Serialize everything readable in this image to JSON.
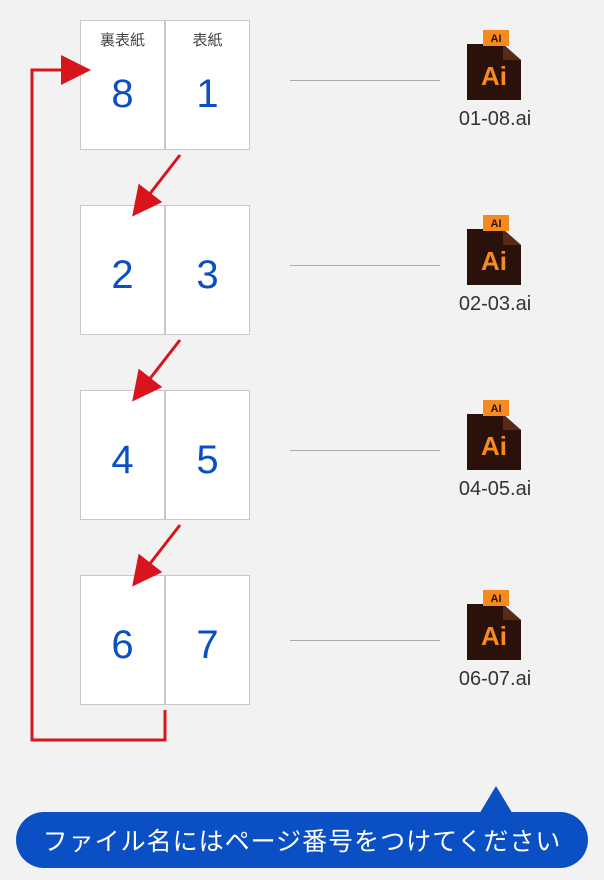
{
  "spreads": [
    {
      "left_label": "裏表紙",
      "left_num": "8",
      "right_label": "表紙",
      "right_num": "1"
    },
    {
      "left_label": "",
      "left_num": "2",
      "right_label": "",
      "right_num": "3"
    },
    {
      "left_label": "",
      "left_num": "4",
      "right_label": "",
      "right_num": "5"
    },
    {
      "left_label": "",
      "left_num": "6",
      "right_label": "",
      "right_num": "7"
    }
  ],
  "files": [
    {
      "name": "01-08.ai"
    },
    {
      "name": "02-03.ai"
    },
    {
      "name": "04-05.ai"
    },
    {
      "name": "06-07.ai"
    }
  ],
  "icon_text": {
    "tag": "AI",
    "letters": "Ai"
  },
  "banner_text": "ファイル名にはページ番号をつけてください"
}
